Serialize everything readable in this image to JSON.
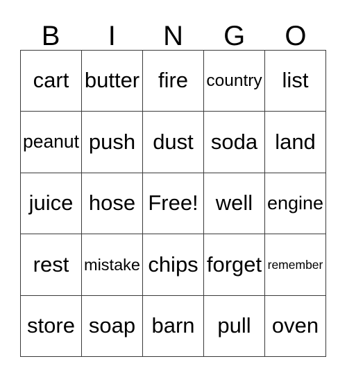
{
  "card": {
    "title": "BINGO",
    "header_letters": [
      "B",
      "I",
      "N",
      "G",
      "O"
    ],
    "free_space_label": "Free!",
    "free_space_position": {
      "row": 2,
      "col": 2
    },
    "grid_size": {
      "rows": 5,
      "columns": 5
    },
    "colors": {
      "background": "#ffffff",
      "text": "#000000",
      "grid_line": "#3a3a3a"
    },
    "rows": [
      [
        "cart",
        "butter",
        "fire",
        "country",
        "list"
      ],
      [
        "peanut",
        "push",
        "dust",
        "soda",
        "land"
      ],
      [
        "juice",
        "hose",
        "Free!",
        "well",
        "engine"
      ],
      [
        "rest",
        "mistake",
        "chips",
        "forget",
        "remember"
      ],
      [
        "store",
        "soap",
        "barn",
        "pull",
        "oven"
      ]
    ],
    "columns": {
      "B": [
        "cart",
        "peanut",
        "juice",
        "rest",
        "store"
      ],
      "I": [
        "butter",
        "push",
        "hose",
        "mistake",
        "soap"
      ],
      "N": [
        "fire",
        "dust",
        "Free!",
        "chips",
        "barn"
      ],
      "G": [
        "country",
        "soda",
        "well",
        "forget",
        "pull"
      ],
      "O": [
        "list",
        "land",
        "engine",
        "remember",
        "oven"
      ]
    }
  }
}
